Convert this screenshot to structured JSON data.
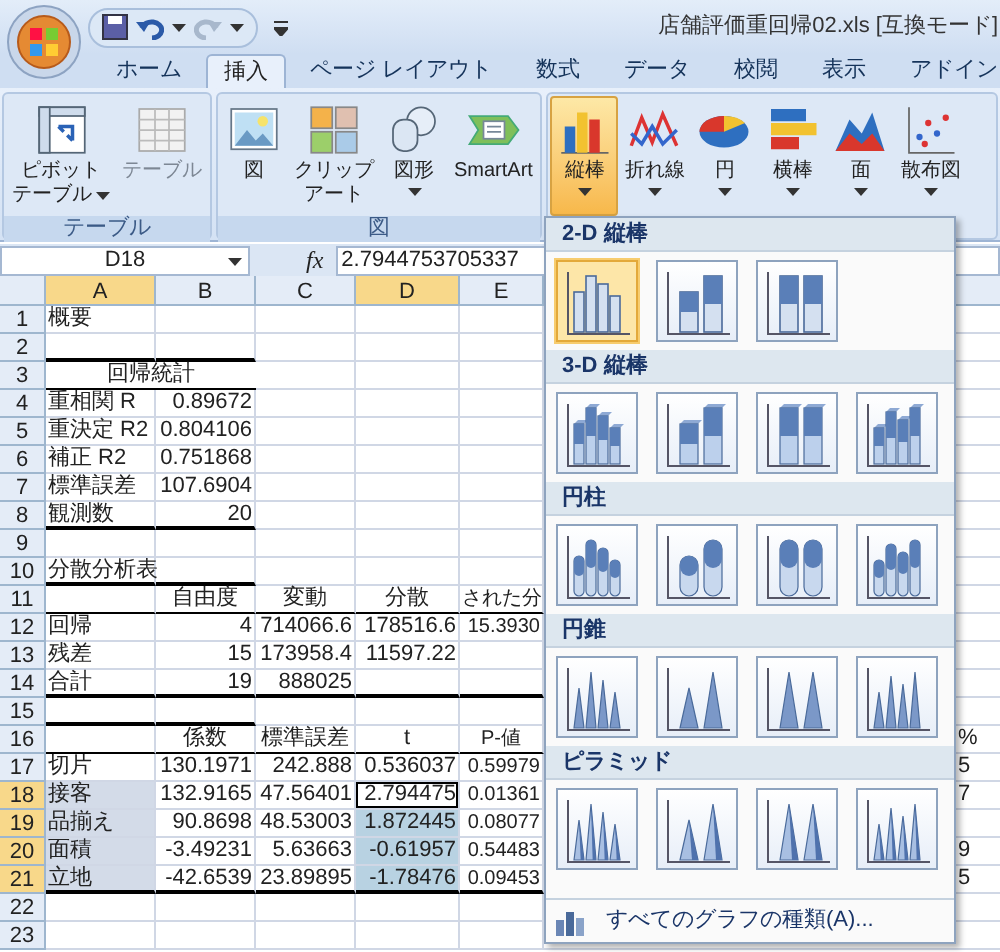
{
  "window": {
    "title": "店舗評価重回帰02.xls  [互換モード]"
  },
  "tabs": [
    {
      "label": "ホーム",
      "selected": false
    },
    {
      "label": "挿入",
      "selected": true
    },
    {
      "label": "ページ レイアウト",
      "selected": false
    },
    {
      "label": "数式",
      "selected": false
    },
    {
      "label": "データ",
      "selected": false
    },
    {
      "label": "校閲",
      "selected": false
    },
    {
      "label": "表示",
      "selected": false
    },
    {
      "label": "アドイン",
      "selected": false
    }
  ],
  "ribbon": {
    "groups": [
      {
        "label": "テーブル",
        "buttons": [
          {
            "kind": "pivot",
            "lines": [
              "ピボット",
              "テーブル"
            ],
            "dropdown": true,
            "disabled": false,
            "selected": false
          },
          {
            "kind": "table",
            "lines": [
              "テーブル"
            ],
            "dropdown": false,
            "disabled": true,
            "selected": false
          }
        ]
      },
      {
        "label": "図",
        "buttons": [
          {
            "kind": "picture",
            "lines": [
              "図"
            ],
            "dropdown": false,
            "disabled": false,
            "selected": false
          },
          {
            "kind": "clipart",
            "lines": [
              "クリップ",
              "アート"
            ],
            "dropdown": false,
            "disabled": false,
            "selected": false
          },
          {
            "kind": "shapes",
            "lines": [
              "図形"
            ],
            "dropdown": true,
            "disabled": false,
            "selected": false
          },
          {
            "kind": "smartart",
            "lines": [
              "SmartArt"
            ],
            "dropdown": false,
            "disabled": false,
            "selected": false
          }
        ]
      },
      {
        "buttons": [
          {
            "kind": "column",
            "lines": [
              "縦棒"
            ],
            "dropdown": true,
            "disabled": false,
            "selected": true
          },
          {
            "kind": "line",
            "lines": [
              "折れ線"
            ],
            "dropdown": true,
            "disabled": false,
            "selected": false
          },
          {
            "kind": "pie",
            "lines": [
              "円"
            ],
            "dropdown": true,
            "disabled": false,
            "selected": false
          },
          {
            "kind": "bar",
            "lines": [
              "横棒"
            ],
            "dropdown": true,
            "disabled": false,
            "selected": false
          },
          {
            "kind": "area",
            "lines": [
              "面"
            ],
            "dropdown": true,
            "disabled": false,
            "selected": false
          },
          {
            "kind": "scatter",
            "lines": [
              "散布図"
            ],
            "dropdown": true,
            "disabled": false,
            "selected": false
          }
        ]
      }
    ]
  },
  "formula_bar": {
    "name_box": "D18",
    "function_label": "fx",
    "formula": "2.7944753705337"
  },
  "sheet": {
    "columns": [
      {
        "label": "A",
        "selected": true,
        "active": false
      },
      {
        "label": "B",
        "selected": false,
        "active": false
      },
      {
        "label": "C",
        "selected": false,
        "active": false
      },
      {
        "label": "D",
        "selected": true,
        "active": true
      },
      {
        "label": "E",
        "selected": false,
        "active": false
      }
    ],
    "rows": [
      {
        "number": "1",
        "selected": false,
        "active": false,
        "kind": "data",
        "cells": [
          "概要"
        ]
      },
      {
        "number": "2",
        "selected": false,
        "active": false,
        "kind": "data"
      },
      {
        "number": "3",
        "selected": false,
        "active": false,
        "kind": "title",
        "cells": [
          "回帰統計"
        ]
      },
      {
        "number": "4",
        "selected": false,
        "active": false,
        "kind": "data",
        "cells": [
          "重相関 R",
          "0.89672"
        ]
      },
      {
        "number": "5",
        "selected": false,
        "active": false,
        "kind": "data",
        "cells": [
          "重決定 R2",
          "0.804106"
        ]
      },
      {
        "number": "6",
        "selected": false,
        "active": false,
        "kind": "data",
        "cells": [
          "補正 R2",
          "0.751868"
        ]
      },
      {
        "number": "7",
        "selected": false,
        "active": false,
        "kind": "data",
        "cells": [
          "標準誤差",
          "107.6904"
        ]
      },
      {
        "number": "8",
        "selected": false,
        "active": false,
        "kind": "data",
        "cells": [
          "観測数",
          "20"
        ]
      },
      {
        "number": "9",
        "selected": false,
        "active": false,
        "kind": "data"
      },
      {
        "number": "10",
        "selected": false,
        "active": false,
        "kind": "data",
        "cells": [
          "分散分析表"
        ]
      },
      {
        "number": "11",
        "selected": false,
        "active": false,
        "kind": "header",
        "cells": [
          null,
          "自由度",
          "変動",
          "分散",
          "された分"
        ]
      },
      {
        "number": "12",
        "selected": false,
        "active": false,
        "kind": "data",
        "cells": [
          "回帰",
          "4",
          "714066.6",
          "178516.6",
          "15.3930"
        ]
      },
      {
        "number": "13",
        "selected": false,
        "active": false,
        "kind": "data",
        "cells": [
          "残差",
          "15",
          "173958.4",
          "11597.22"
        ]
      },
      {
        "number": "14",
        "selected": false,
        "active": false,
        "kind": "data",
        "cells": [
          "合計",
          "19",
          "888025"
        ]
      },
      {
        "number": "15",
        "selected": false,
        "active": false,
        "kind": "data"
      },
      {
        "number": "16",
        "selected": false,
        "active": false,
        "kind": "header",
        "cells": [
          null,
          "係数",
          "標準誤差",
          "t",
          "P-値"
        ],
        "edge": "%"
      },
      {
        "number": "17",
        "selected": false,
        "active": false,
        "kind": "data",
        "cells": [
          "切片",
          "130.1971",
          "242.888",
          "0.536037",
          "0.59979"
        ],
        "edge": "5"
      },
      {
        "number": "18",
        "selected": true,
        "active": true,
        "kind": "data",
        "cells": [
          "接客",
          "132.9165",
          "47.56401",
          "2.794475",
          "0.01361"
        ],
        "edge": "7"
      },
      {
        "number": "19",
        "selected": true,
        "active": false,
        "kind": "data",
        "cells": [
          "品揃え",
          "90.8698",
          "48.53003",
          "1.872445",
          "0.08077"
        ]
      },
      {
        "number": "20",
        "selected": true,
        "active": false,
        "kind": "data",
        "cells": [
          "面積",
          "-3.49231",
          "5.63663",
          "-0.61957",
          "0.54483"
        ],
        "edge": "9"
      },
      {
        "number": "21",
        "selected": true,
        "active": false,
        "kind": "data",
        "cells": [
          "立地",
          "-42.6539",
          "23.89895",
          "-1.78476",
          "0.09453"
        ],
        "edge": "5"
      },
      {
        "number": "22",
        "selected": false,
        "active": false,
        "kind": "data"
      },
      {
        "number": "23",
        "selected": false,
        "active": false,
        "kind": "data"
      }
    ]
  },
  "gallery": {
    "sections": [
      {
        "title": "2-D 縦棒",
        "kind": "flat",
        "items": [
          {
            "kind": "clustered",
            "selected": true
          },
          {
            "kind": "stacked",
            "selected": false
          },
          {
            "kind": "percent",
            "selected": false
          }
        ]
      },
      {
        "title": "3-D 縦棒",
        "kind": "box",
        "items": [
          {
            "kind": "clustered",
            "selected": false
          },
          {
            "kind": "stacked",
            "selected": false
          },
          {
            "kind": "percent",
            "selected": false
          },
          {
            "kind": "deep",
            "selected": false
          }
        ]
      },
      {
        "title": "円柱",
        "kind": "cylinder",
        "items": [
          {
            "kind": "clustered",
            "selected": false
          },
          {
            "kind": "stacked",
            "selected": false
          },
          {
            "kind": "percent",
            "selected": false
          },
          {
            "kind": "deep",
            "selected": false
          }
        ]
      },
      {
        "title": "円錐",
        "kind": "cone",
        "items": [
          {
            "kind": "clustered",
            "selected": false
          },
          {
            "kind": "stacked",
            "selected": false
          },
          {
            "kind": "percent",
            "selected": false
          },
          {
            "kind": "deep",
            "selected": false
          }
        ]
      },
      {
        "title": "ピラミッド",
        "kind": "pyramid",
        "items": [
          {
            "kind": "clustered",
            "selected": false
          },
          {
            "kind": "stacked",
            "selected": false
          },
          {
            "kind": "percent",
            "selected": false
          },
          {
            "kind": "deep",
            "selected": false
          }
        ]
      }
    ],
    "footer": "すべてのグラフの種類(A)..."
  }
}
